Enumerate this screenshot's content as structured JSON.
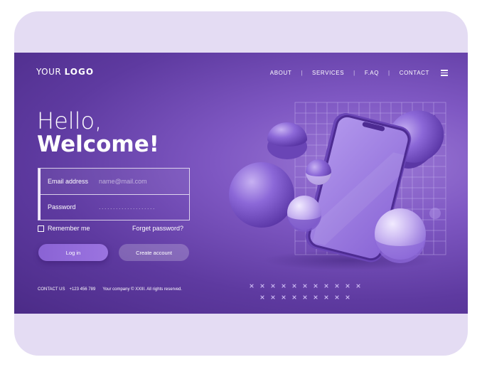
{
  "brand": {
    "logo_light": "YOUR",
    "logo_bold": "LOGO"
  },
  "nav": {
    "items": [
      "ABOUT",
      "SERVICES",
      "F.AQ",
      "CONTACT"
    ],
    "separator": "|"
  },
  "hero": {
    "hello": "Hello,",
    "welcome": "Welcome!"
  },
  "form": {
    "email_label": "Email address",
    "email_placeholder": "name@mail.com",
    "password_label": "Password",
    "password_mask": "...................."
  },
  "options": {
    "remember_label": "Remember me",
    "forgot_label": "Forget password?"
  },
  "buttons": {
    "login_label": "Log in",
    "create_label": "Create account"
  },
  "footer": {
    "contact_label": "CONTACT US",
    "phone": "+123 456 789",
    "copyright": "Your company © XXIII. All rights reserved."
  },
  "colors": {
    "primary": "#5e3aa0",
    "accent": "#9b74e0",
    "background": "#e4dcf3"
  },
  "icons": {
    "menu": "hamburger-menu-icon",
    "remember": "checkbox-icon"
  }
}
